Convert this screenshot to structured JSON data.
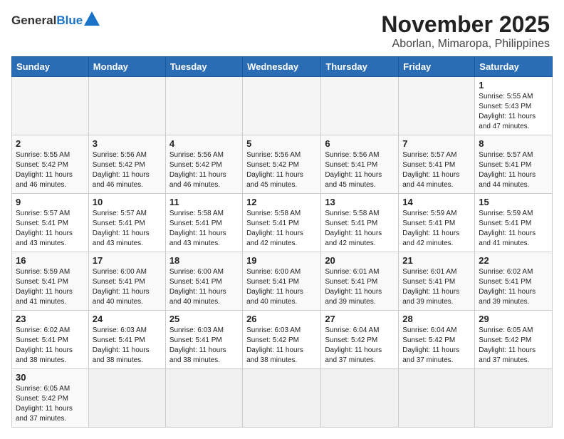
{
  "header": {
    "title": "November 2025",
    "subtitle": "Aborlan, Mimaropa, Philippines",
    "logo_general": "General",
    "logo_blue": "Blue"
  },
  "weekdays": [
    "Sunday",
    "Monday",
    "Tuesday",
    "Wednesday",
    "Thursday",
    "Friday",
    "Saturday"
  ],
  "weeks": [
    [
      {
        "day": "",
        "info": ""
      },
      {
        "day": "",
        "info": ""
      },
      {
        "day": "",
        "info": ""
      },
      {
        "day": "",
        "info": ""
      },
      {
        "day": "",
        "info": ""
      },
      {
        "day": "",
        "info": ""
      },
      {
        "day": "1",
        "info": "Sunrise: 5:55 AM\nSunset: 5:43 PM\nDaylight: 11 hours\nand 47 minutes."
      }
    ],
    [
      {
        "day": "2",
        "info": "Sunrise: 5:55 AM\nSunset: 5:42 PM\nDaylight: 11 hours\nand 46 minutes."
      },
      {
        "day": "3",
        "info": "Sunrise: 5:56 AM\nSunset: 5:42 PM\nDaylight: 11 hours\nand 46 minutes."
      },
      {
        "day": "4",
        "info": "Sunrise: 5:56 AM\nSunset: 5:42 PM\nDaylight: 11 hours\nand 46 minutes."
      },
      {
        "day": "5",
        "info": "Sunrise: 5:56 AM\nSunset: 5:42 PM\nDaylight: 11 hours\nand 45 minutes."
      },
      {
        "day": "6",
        "info": "Sunrise: 5:56 AM\nSunset: 5:41 PM\nDaylight: 11 hours\nand 45 minutes."
      },
      {
        "day": "7",
        "info": "Sunrise: 5:57 AM\nSunset: 5:41 PM\nDaylight: 11 hours\nand 44 minutes."
      },
      {
        "day": "8",
        "info": "Sunrise: 5:57 AM\nSunset: 5:41 PM\nDaylight: 11 hours\nand 44 minutes."
      }
    ],
    [
      {
        "day": "9",
        "info": "Sunrise: 5:57 AM\nSunset: 5:41 PM\nDaylight: 11 hours\nand 43 minutes."
      },
      {
        "day": "10",
        "info": "Sunrise: 5:57 AM\nSunset: 5:41 PM\nDaylight: 11 hours\nand 43 minutes."
      },
      {
        "day": "11",
        "info": "Sunrise: 5:58 AM\nSunset: 5:41 PM\nDaylight: 11 hours\nand 43 minutes."
      },
      {
        "day": "12",
        "info": "Sunrise: 5:58 AM\nSunset: 5:41 PM\nDaylight: 11 hours\nand 42 minutes."
      },
      {
        "day": "13",
        "info": "Sunrise: 5:58 AM\nSunset: 5:41 PM\nDaylight: 11 hours\nand 42 minutes."
      },
      {
        "day": "14",
        "info": "Sunrise: 5:59 AM\nSunset: 5:41 PM\nDaylight: 11 hours\nand 42 minutes."
      },
      {
        "day": "15",
        "info": "Sunrise: 5:59 AM\nSunset: 5:41 PM\nDaylight: 11 hours\nand 41 minutes."
      }
    ],
    [
      {
        "day": "16",
        "info": "Sunrise: 5:59 AM\nSunset: 5:41 PM\nDaylight: 11 hours\nand 41 minutes."
      },
      {
        "day": "17",
        "info": "Sunrise: 6:00 AM\nSunset: 5:41 PM\nDaylight: 11 hours\nand 40 minutes."
      },
      {
        "day": "18",
        "info": "Sunrise: 6:00 AM\nSunset: 5:41 PM\nDaylight: 11 hours\nand 40 minutes."
      },
      {
        "day": "19",
        "info": "Sunrise: 6:00 AM\nSunset: 5:41 PM\nDaylight: 11 hours\nand 40 minutes."
      },
      {
        "day": "20",
        "info": "Sunrise: 6:01 AM\nSunset: 5:41 PM\nDaylight: 11 hours\nand 39 minutes."
      },
      {
        "day": "21",
        "info": "Sunrise: 6:01 AM\nSunset: 5:41 PM\nDaylight: 11 hours\nand 39 minutes."
      },
      {
        "day": "22",
        "info": "Sunrise: 6:02 AM\nSunset: 5:41 PM\nDaylight: 11 hours\nand 39 minutes."
      }
    ],
    [
      {
        "day": "23",
        "info": "Sunrise: 6:02 AM\nSunset: 5:41 PM\nDaylight: 11 hours\nand 38 minutes."
      },
      {
        "day": "24",
        "info": "Sunrise: 6:03 AM\nSunset: 5:41 PM\nDaylight: 11 hours\nand 38 minutes."
      },
      {
        "day": "25",
        "info": "Sunrise: 6:03 AM\nSunset: 5:41 PM\nDaylight: 11 hours\nand 38 minutes."
      },
      {
        "day": "26",
        "info": "Sunrise: 6:03 AM\nSunset: 5:42 PM\nDaylight: 11 hours\nand 38 minutes."
      },
      {
        "day": "27",
        "info": "Sunrise: 6:04 AM\nSunset: 5:42 PM\nDaylight: 11 hours\nand 37 minutes."
      },
      {
        "day": "28",
        "info": "Sunrise: 6:04 AM\nSunset: 5:42 PM\nDaylight: 11 hours\nand 37 minutes."
      },
      {
        "day": "29",
        "info": "Sunrise: 6:05 AM\nSunset: 5:42 PM\nDaylight: 11 hours\nand 37 minutes."
      }
    ],
    [
      {
        "day": "30",
        "info": "Sunrise: 6:05 AM\nSunset: 5:42 PM\nDaylight: 11 hours\nand 37 minutes."
      },
      {
        "day": "",
        "info": ""
      },
      {
        "day": "",
        "info": ""
      },
      {
        "day": "",
        "info": ""
      },
      {
        "day": "",
        "info": ""
      },
      {
        "day": "",
        "info": ""
      },
      {
        "day": "",
        "info": ""
      }
    ]
  ]
}
